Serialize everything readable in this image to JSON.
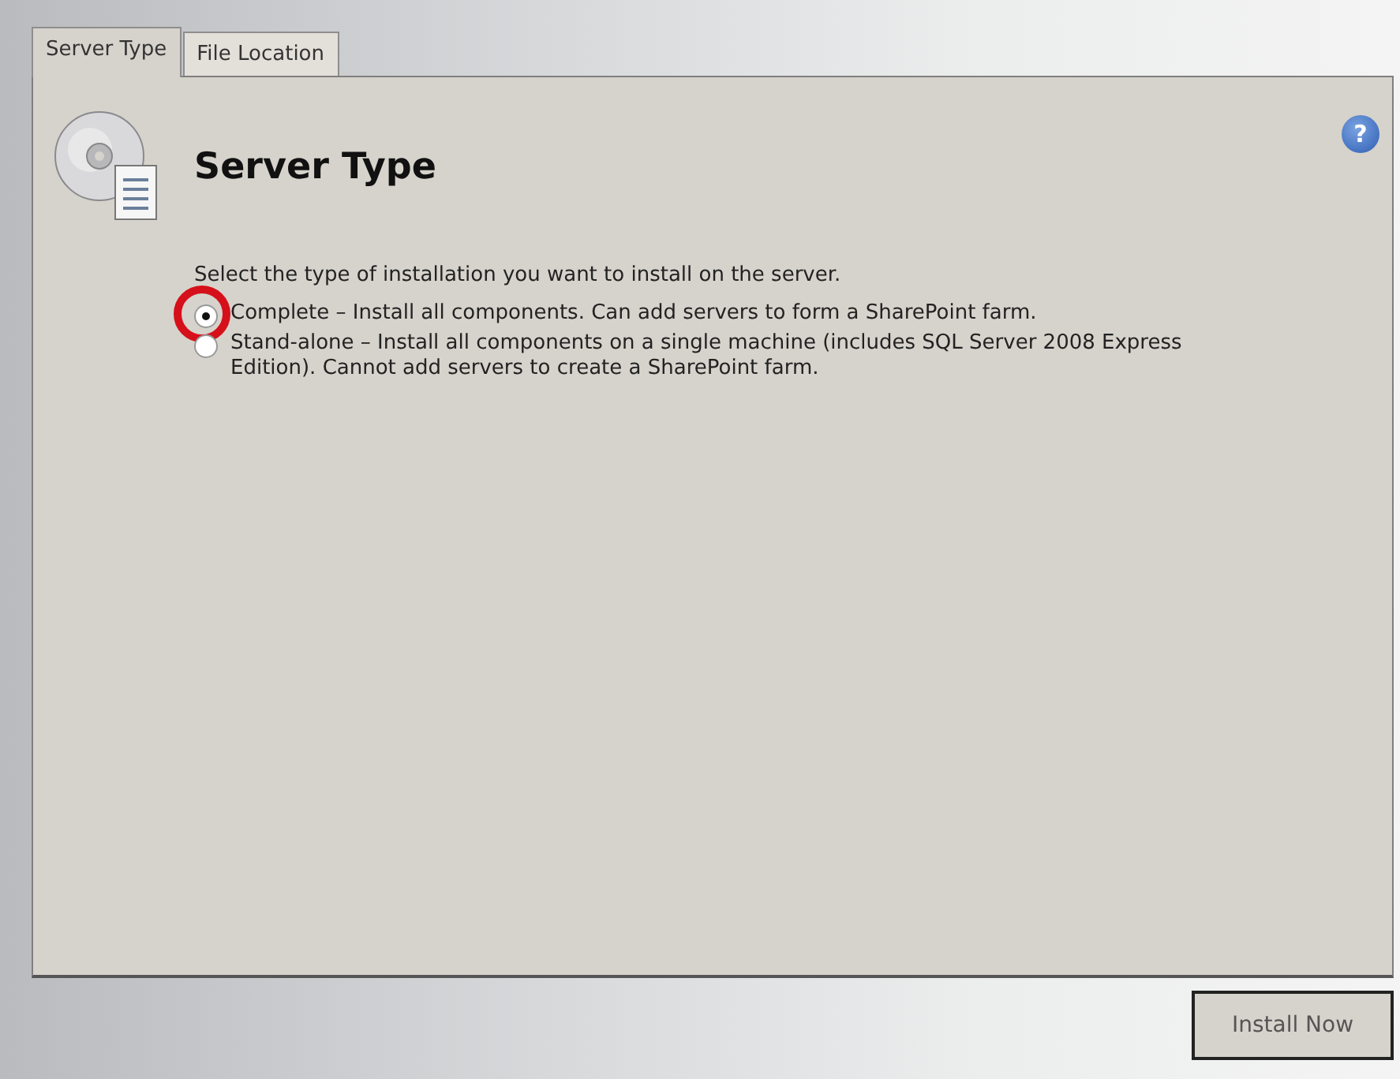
{
  "tabs": [
    {
      "label": "Server Type",
      "selected": true
    },
    {
      "label": "File Location",
      "selected": false
    }
  ],
  "heading": "Server Type",
  "help": "?",
  "instruction": "Select the type of installation you want to install on the server.",
  "options": [
    {
      "label": "Complete – Install all components. Can add servers to form a SharePoint farm.",
      "selected": true,
      "highlighted": true
    },
    {
      "label": "Stand-alone – Install all components on a single machine (includes SQL Server 2008 Express Edition). Cannot add servers to create a SharePoint farm.",
      "selected": false,
      "highlighted": false
    }
  ],
  "buttons": [
    "Install Now"
  ]
}
